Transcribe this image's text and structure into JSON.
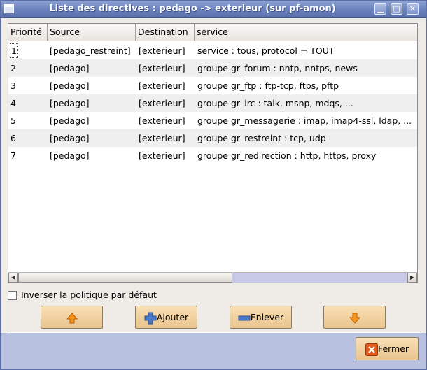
{
  "window": {
    "title": "Liste des directives : pedago -> exterieur (sur pf-amon)",
    "controls": {
      "minimize": "▁",
      "maximize": "□",
      "close": "✕"
    }
  },
  "table": {
    "columns": [
      "Priorité",
      "Source",
      "Destination",
      "service"
    ],
    "rows": [
      {
        "priority": "1",
        "source": "[pedago_restreint]",
        "destination": "[exterieur]",
        "service": "service : tous, protocol = TOUT"
      },
      {
        "priority": "2",
        "source": "[pedago]",
        "destination": "[exterieur]",
        "service": "groupe gr_forum : nntp, nntps, news"
      },
      {
        "priority": "3",
        "source": "[pedago]",
        "destination": "[exterieur]",
        "service": "groupe gr_ftp : ftp-tcp, ftps, pftp"
      },
      {
        "priority": "4",
        "source": "[pedago]",
        "destination": "[exterieur]",
        "service": "groupe gr_irc : talk, msnp, mdqs, ..."
      },
      {
        "priority": "5",
        "source": "[pedago]",
        "destination": "[exterieur]",
        "service": "groupe gr_messagerie : imap, imap4-ssl, ldap, ..."
      },
      {
        "priority": "6",
        "source": "[pedago]",
        "destination": "[exterieur]",
        "service": "groupe gr_restreint : tcp, udp"
      },
      {
        "priority": "7",
        "source": "[pedago]",
        "destination": "[exterieur]",
        "service": "groupe gr_redirection : http, https, proxy"
      }
    ]
  },
  "options": {
    "invert_label": "Inverser la politique par défaut",
    "invert_checked": false
  },
  "buttons": {
    "up_icon": "arrow-up-icon",
    "add_label": "Ajouter",
    "remove_label": "Enlever",
    "down_icon": "arrow-down-icon",
    "close_label": "Fermer"
  },
  "colors": {
    "titlebar": "#6f86c1",
    "button_bg": "#f2d3a2",
    "footer_bg": "#b8c2e0",
    "arrow_orange": "#f7941d",
    "add_blue": "#4a79c8",
    "close_red": "#e25a1c"
  }
}
